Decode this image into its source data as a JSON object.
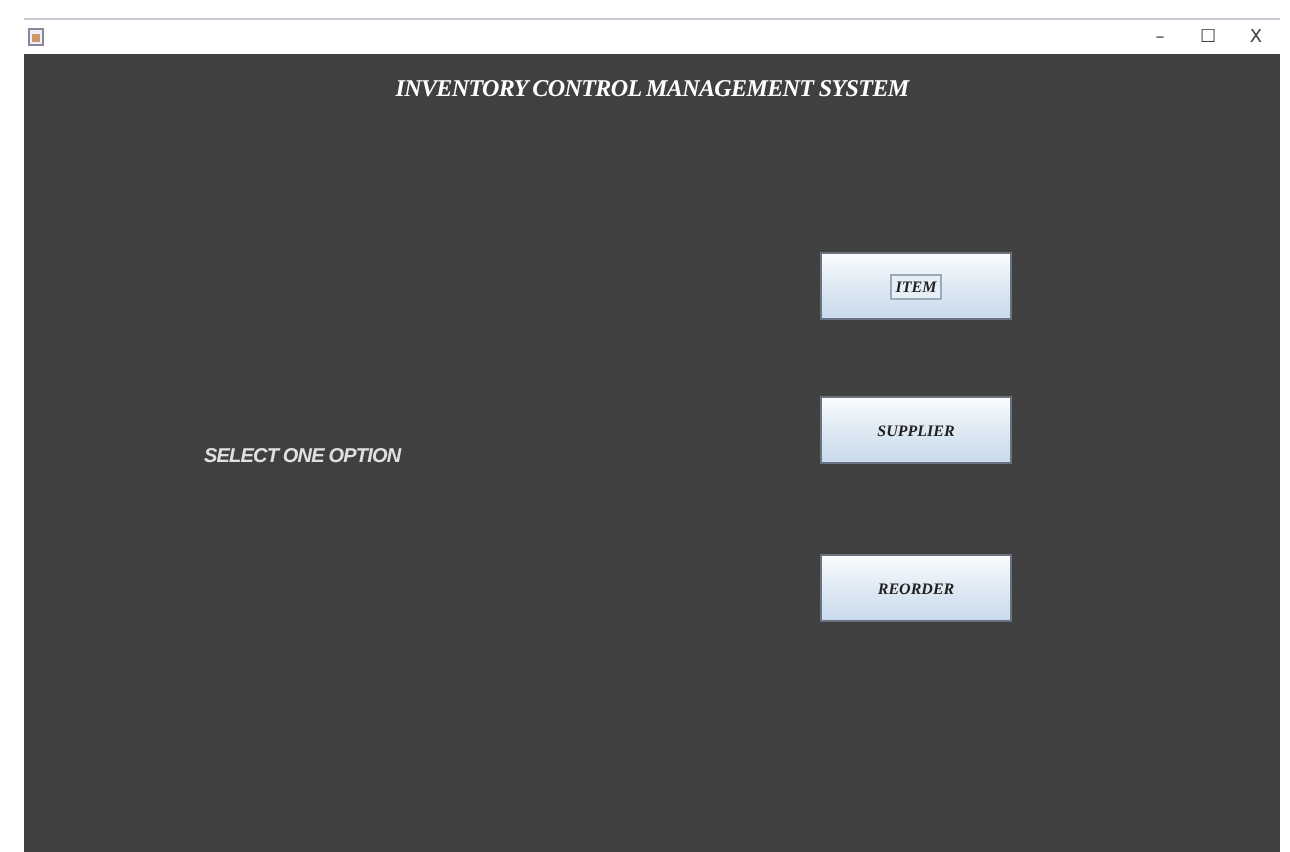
{
  "window": {
    "title": "INVENTORY CONTROL MANAGEMENT SYSTEM",
    "controls": [
      "–",
      "☐",
      "X"
    ]
  },
  "prompt": "SELECT ONE OPTION",
  "buttons": [
    {
      "label": "ITEM",
      "focused": true
    },
    {
      "label": "SUPPLIER",
      "focused": false
    },
    {
      "label": "REORDER",
      "focused": false
    }
  ]
}
